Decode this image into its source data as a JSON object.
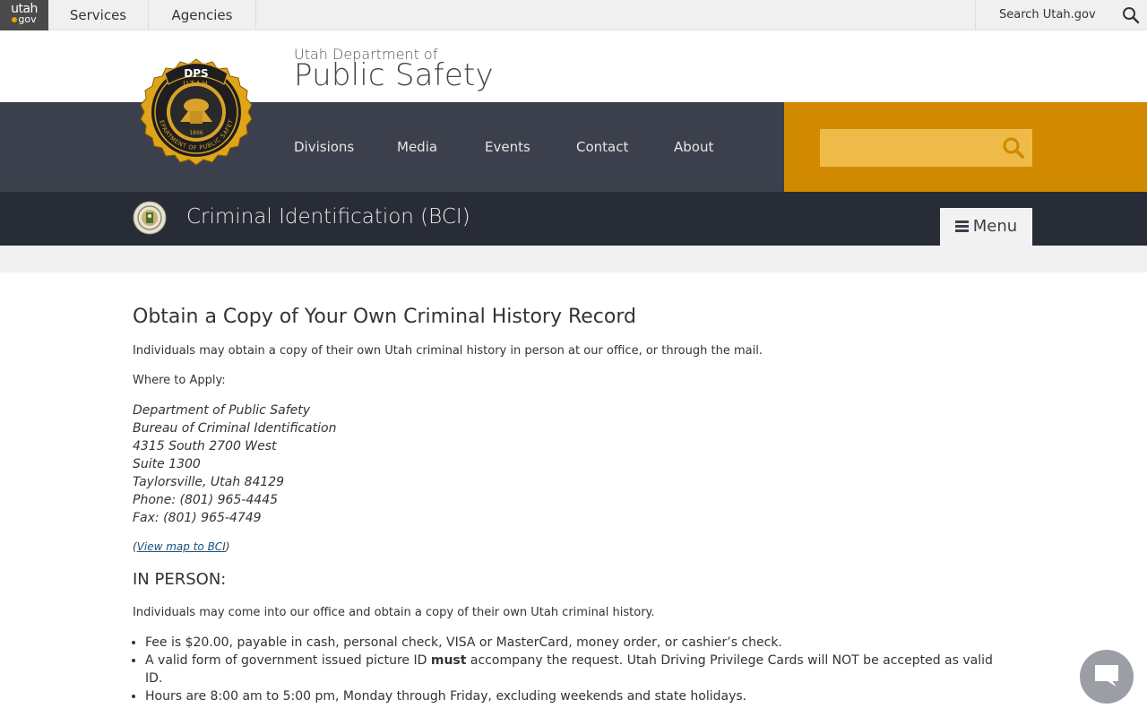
{
  "topbar": {
    "logo_line1": "utah",
    "logo_line2": "gov",
    "services": "Services",
    "agencies": "Agencies",
    "search_label": "Search Utah.gov"
  },
  "header": {
    "dept_line1": "Utah Department of",
    "dept_line2": "Public Safety",
    "seal": {
      "top": "DPS",
      "arc": "UTAH",
      "ring": "DEPARTMENT OF PUBLIC SAFETY",
      "year": "1896"
    }
  },
  "nav": {
    "items": [
      "Divisions",
      "Media",
      "Events",
      "Contact",
      "About"
    ],
    "search_placeholder": ""
  },
  "section": {
    "title": "Criminal Identification (BCI)",
    "menu_label": "Menu"
  },
  "content": {
    "title": "Obtain a Copy of Your Own Criminal History Record",
    "intro": "Individuals may obtain a copy of their own Utah criminal history in person at our office, or through the mail.",
    "where_label": "Where to Apply:",
    "address": [
      "Department of Public Safety",
      "Bureau of Criminal Identification",
      "4315 South 2700 West",
      "Suite 1300",
      "Taylorsville, Utah 84129",
      "Phone: (801) 965-4445",
      "Fax: (801) 965-4749"
    ],
    "map_open": "(",
    "map_link": "View map to BCI",
    "map_close": ")",
    "in_person_heading": "IN PERSON:",
    "in_person_text": "Individuals may come into our office and obtain a copy of their own Utah criminal history.",
    "bullets": {
      "fee": "Fee is $20.00, payable in cash, personal check, VISA or MasterCard, money order, or cashier’s check.",
      "id_pre": "A valid form of government issued picture ID ",
      "id_bold": "must",
      "id_post": " accompany the request. Utah Driving Privilege Cards will NOT be accepted as valid ID.",
      "hours": "Hours are 8:00 am to 5:00 pm, Monday through Friday, excluding weekends and state holidays."
    }
  },
  "colors": {
    "nav_bg": "#3b404c",
    "accent_orange": "#d18a00",
    "search_fill": "#eebb48",
    "bci_bg": "#282c36"
  },
  "icons": [
    "search-icon",
    "hamburger-icon",
    "chat-icon"
  ]
}
